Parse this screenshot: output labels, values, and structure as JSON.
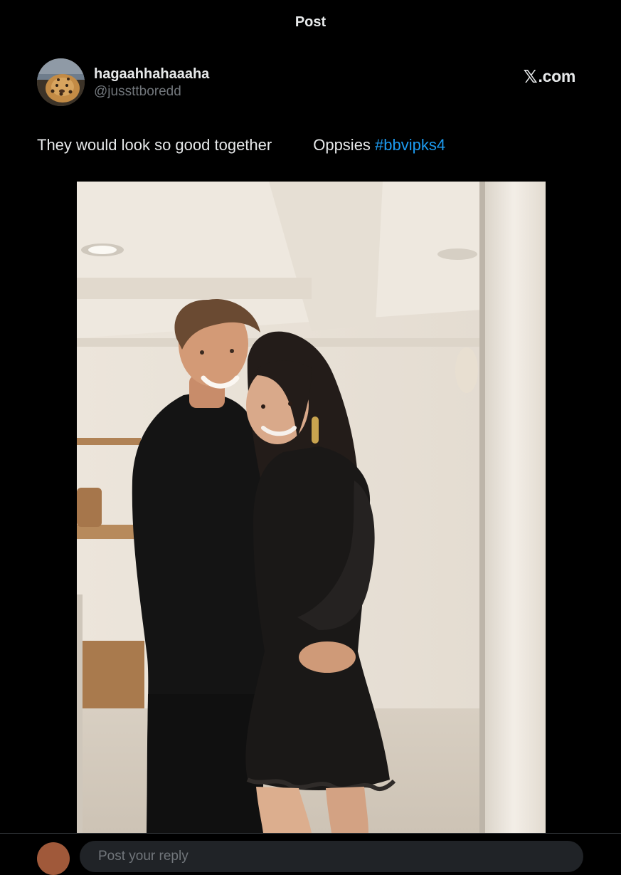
{
  "header": {
    "title": "Post"
  },
  "post": {
    "author": {
      "display_name": "hagaahhahaaaha",
      "handle": "@jussttboredd"
    },
    "source_label": ".com",
    "source_glyph": "𝕏",
    "text_part1": "They would look so good together",
    "text_part2": "Oppsies ",
    "hashtag": "#bbvipks4",
    "media": {
      "type": "photo"
    }
  },
  "reply": {
    "placeholder": "Post your reply"
  },
  "colors": {
    "background": "#000000",
    "text": "#e7e9ea",
    "secondary_text": "#71767b",
    "link": "#1d9bf0"
  }
}
